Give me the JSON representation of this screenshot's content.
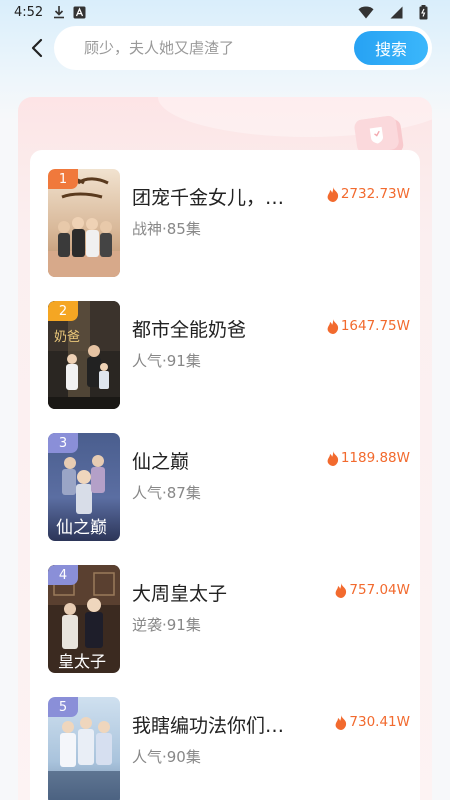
{
  "status_bar": {
    "time": "4:52",
    "icons": [
      "download-icon",
      "notification-a-icon",
      "wifi-icon",
      "signal-icon",
      "battery-icon"
    ]
  },
  "search": {
    "placeholder": "顾少，夫人她又虐渣了",
    "button_label": "搜索"
  },
  "colors": {
    "accent": "#2ea9f6",
    "heat": "#f26a2e",
    "rank1": "#f0793c",
    "rank2": "#f5a623",
    "rank3": "#8a8fd8",
    "card_bg": "#fbeaea"
  },
  "list": [
    {
      "rank": "1",
      "title": "团宠千金女儿，…",
      "meta": "战神·85集",
      "heat": "2732.73W"
    },
    {
      "rank": "2",
      "title": "都市全能奶爸",
      "meta": "人气·91集",
      "heat": "1647.75W"
    },
    {
      "rank": "3",
      "title": "仙之巅",
      "meta": "人气·87集",
      "heat": "1189.88W"
    },
    {
      "rank": "4",
      "title": "大周皇太子",
      "meta": "逆袭·91集",
      "heat": "757.04W"
    },
    {
      "rank": "5",
      "title": "我瞎编功法你们…",
      "meta": "人气·90集",
      "heat": "730.41W"
    }
  ]
}
